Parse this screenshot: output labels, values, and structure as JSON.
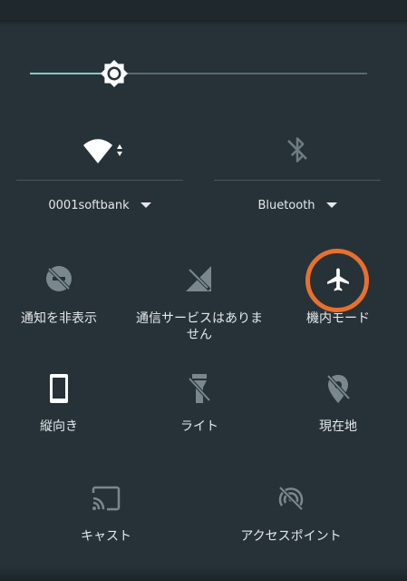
{
  "brightness": {
    "level": 0.25
  },
  "wifi": {
    "network": "0001softbank",
    "icon": "wifi-icon"
  },
  "bluetooth": {
    "label": "Bluetooth",
    "icon": "bluetooth-off-icon"
  },
  "tiles": [
    {
      "label": "通知を非表示",
      "icon": "do-not-disturb-off-icon"
    },
    {
      "label": "通信サービスはありま",
      "label2": "せん",
      "icon": "no-sim-signal-icon"
    },
    {
      "label": "機内モード",
      "icon": "airplane-icon"
    },
    {
      "label": "縦向き",
      "icon": "portrait-phone-icon"
    },
    {
      "label": "ライト",
      "icon": "flashlight-off-icon"
    },
    {
      "label": "現在地",
      "icon": "location-off-icon"
    },
    {
      "label": "キャスト",
      "icon": "cast-icon"
    },
    {
      "label": "アクセスポイント",
      "icon": "hotspot-off-icon"
    }
  ],
  "colors": {
    "background": "#263238",
    "accent": "#80cbc4",
    "highlight": "#e8702e"
  }
}
